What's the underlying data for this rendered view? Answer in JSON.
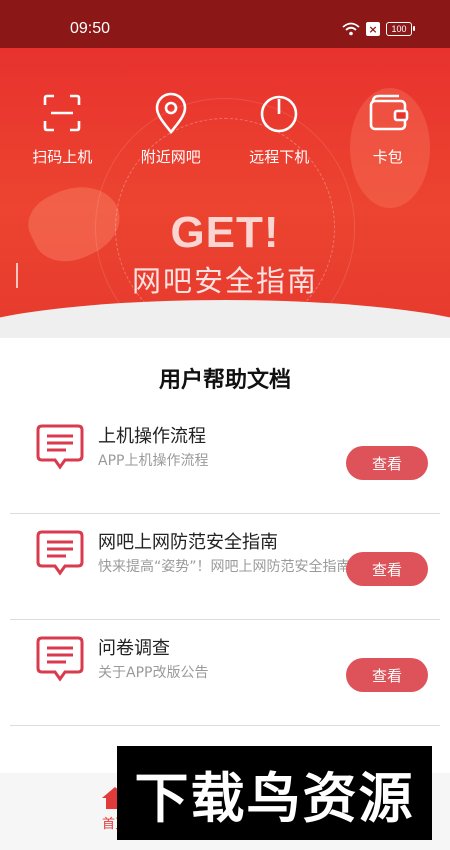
{
  "status_bar": {
    "time": "09:50",
    "battery": "100"
  },
  "quick_nav": [
    {
      "label": "扫码上机",
      "icon": "scan-icon"
    },
    {
      "label": "附近网吧",
      "icon": "location-pin-icon"
    },
    {
      "label": "远程下机",
      "icon": "power-icon"
    },
    {
      "label": "卡包",
      "icon": "wallet-icon"
    }
  ],
  "hero": {
    "headline": "GET!",
    "subtitle": "网吧安全指南"
  },
  "docs": {
    "title": "用户帮助文档",
    "items": [
      {
        "title": "上机操作流程",
        "subtitle": "APP上机操作流程",
        "button": "查看"
      },
      {
        "title": "网吧上网防范安全指南",
        "subtitle": "快来提高“姿势”！网吧上网防范安全指南",
        "button": "查看"
      },
      {
        "title": "问卷调查",
        "subtitle": "关于APP改版公告",
        "button": "查看"
      }
    ]
  },
  "tabbar": {
    "home_label": "首页"
  },
  "watermark": "下载鸟资源",
  "colors": {
    "status_bar": "#8c1717",
    "hero": "#e8322e",
    "button": "#de5259",
    "icon": "#d93a4c"
  }
}
